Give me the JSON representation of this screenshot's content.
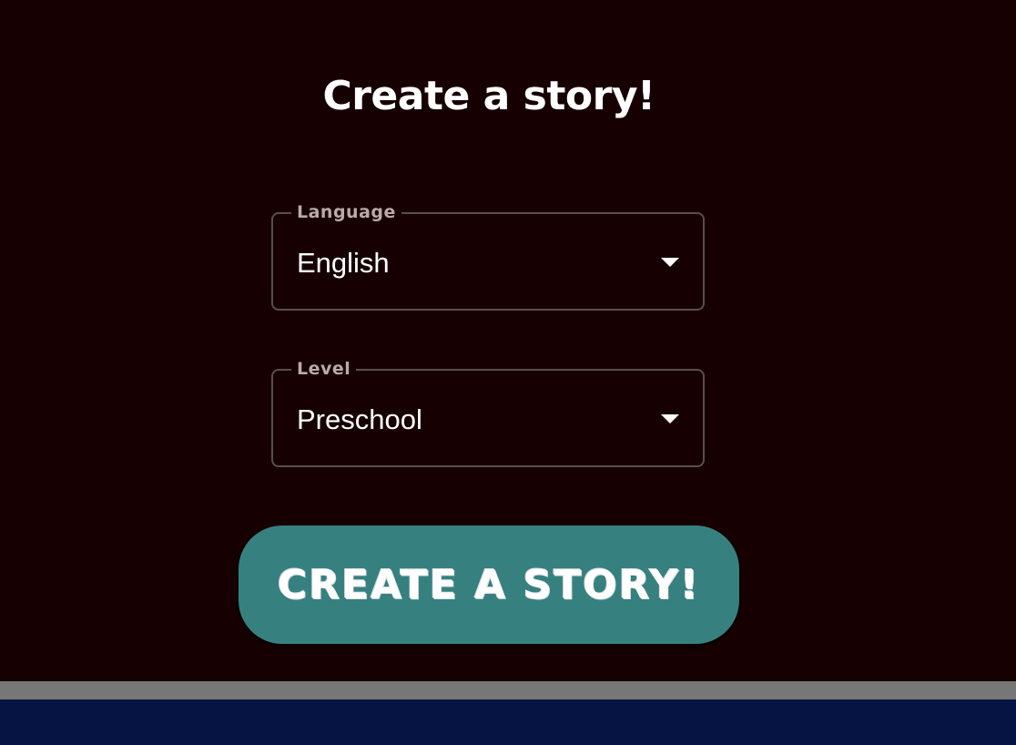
{
  "page": {
    "title": "Create a story!"
  },
  "form": {
    "language": {
      "label": "Language",
      "value": "English"
    },
    "level": {
      "label": "Level",
      "value": "Preschool"
    },
    "submit_label": "CREATE A STORY!"
  },
  "icons": {
    "dropdown": "caret-down-icon"
  },
  "colors": {
    "background": "#170002",
    "button": "#368180",
    "divider": "#777777",
    "footer": "#061443"
  }
}
